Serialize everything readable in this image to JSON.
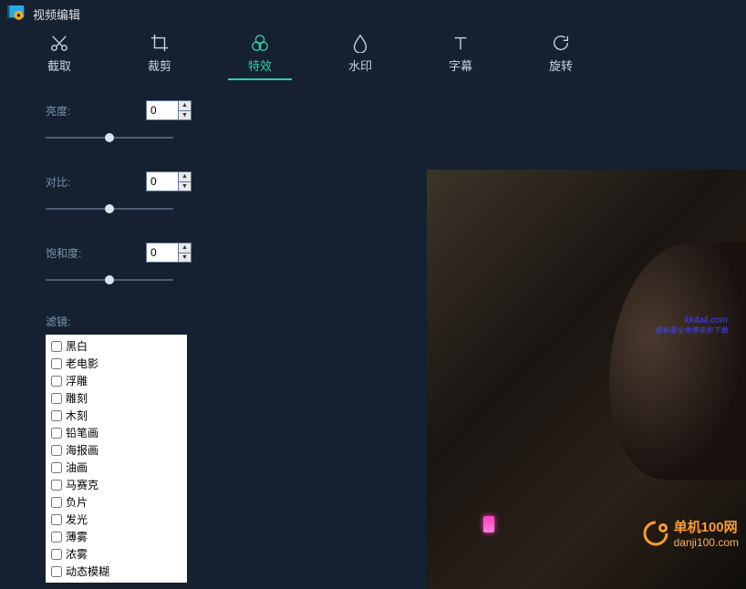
{
  "app": {
    "title": "视频编辑"
  },
  "tabs": [
    {
      "id": "cut",
      "label": "截取"
    },
    {
      "id": "crop",
      "label": "裁剪"
    },
    {
      "id": "effects",
      "label": "特效",
      "active": true
    },
    {
      "id": "watermark",
      "label": "水印"
    },
    {
      "id": "subtitle",
      "label": "字幕"
    },
    {
      "id": "rotate",
      "label": "旋转"
    }
  ],
  "sliders": {
    "brightness": {
      "label": "亮度:",
      "value": "0",
      "pos": 50
    },
    "contrast": {
      "label": "对比:",
      "value": "0",
      "pos": 50
    },
    "saturation": {
      "label": "饱和度:",
      "value": "0",
      "pos": 50
    }
  },
  "filter": {
    "label": "滤镜:",
    "items": [
      "黑白",
      "老电影",
      "浮雕",
      "雕刻",
      "木刻",
      "铅笔画",
      "海报画",
      "油画",
      "马赛克",
      "负片",
      "发光",
      "薄雾",
      "浓雾",
      "动态模糊"
    ]
  },
  "preview": {
    "overlay_line1": "kk4all.com",
    "overlay_line2": "最新最全免费电影下载"
  },
  "watermark": {
    "site_name": "单机100网",
    "site_url": "danji100.com"
  }
}
